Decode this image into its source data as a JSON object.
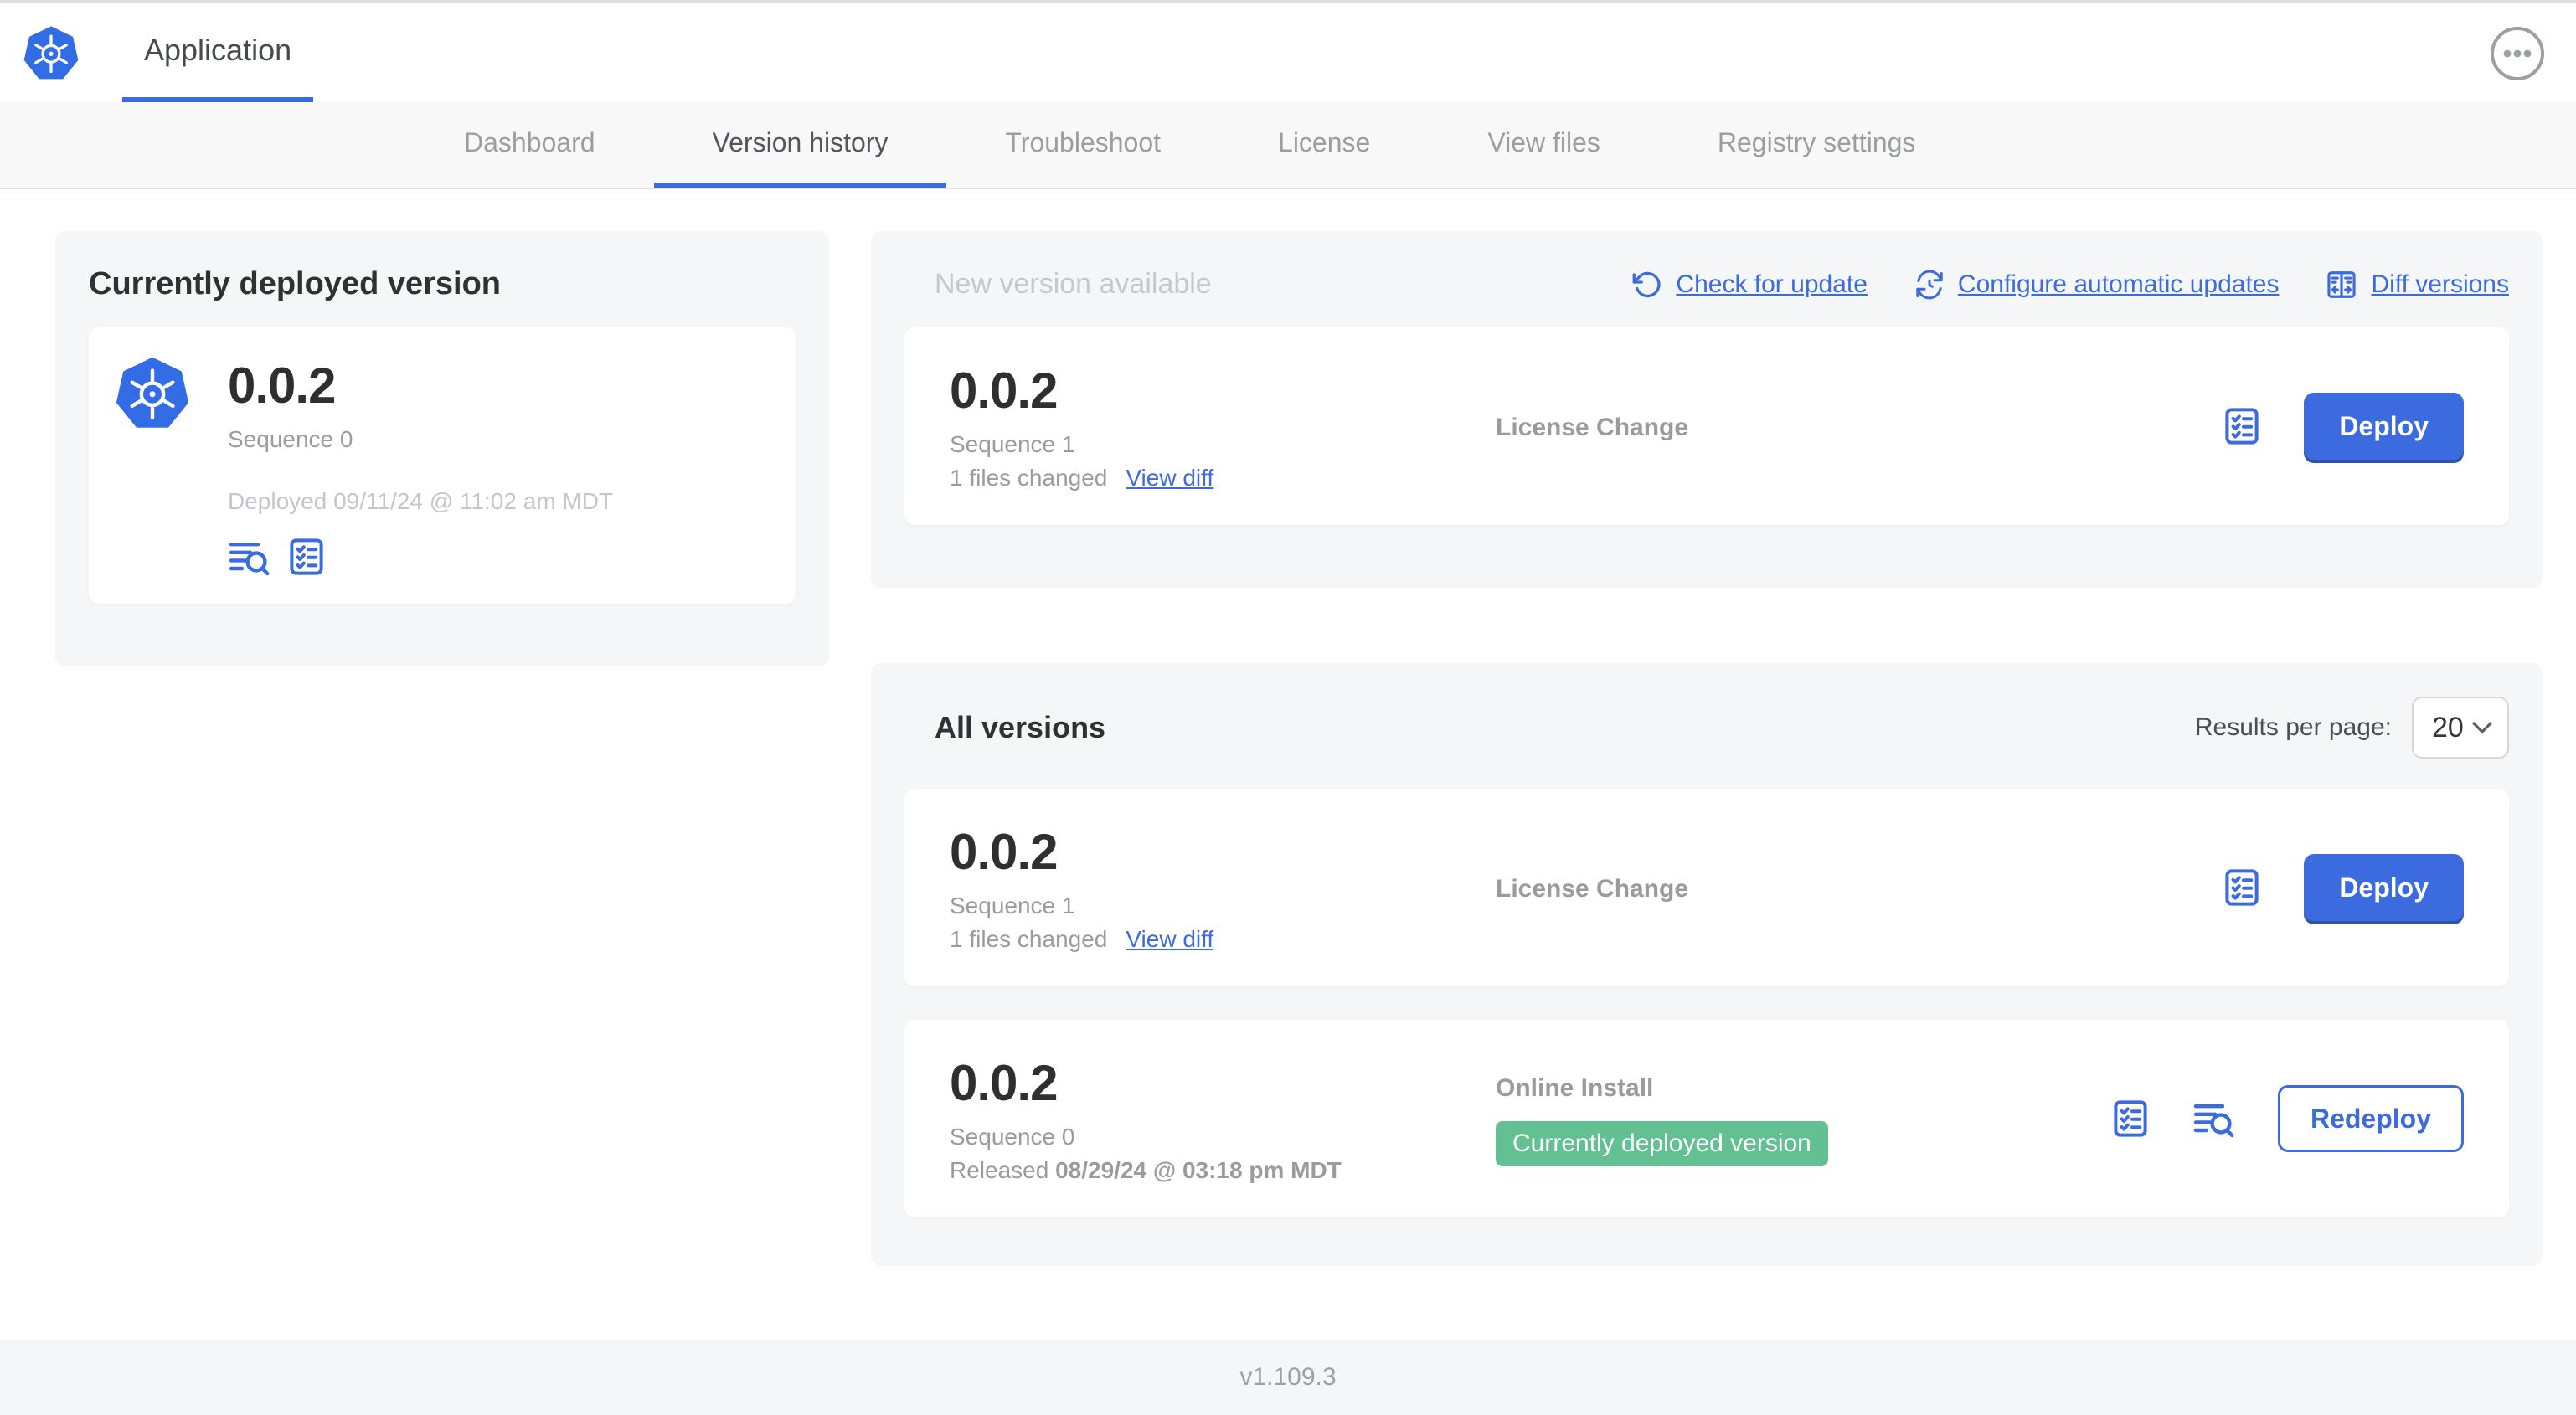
{
  "header": {
    "app_tab": "Application"
  },
  "nav": {
    "tabs": [
      {
        "label": "Dashboard"
      },
      {
        "label": "Version history"
      },
      {
        "label": "Troubleshoot"
      },
      {
        "label": "License"
      },
      {
        "label": "View files"
      },
      {
        "label": "Registry settings"
      }
    ]
  },
  "deployed_panel": {
    "title": "Currently deployed version",
    "version": "0.0.2",
    "sequence": "Sequence 0",
    "deployed_at": "Deployed 09/11/24 @ 11:02 am MDT"
  },
  "new_version_panel": {
    "title": "New version available",
    "links": {
      "check_for_update": "Check for update",
      "configure_automatic_updates": "Configure automatic updates",
      "diff_versions": "Diff versions"
    },
    "card": {
      "version": "0.0.2",
      "sequence": "Sequence 1",
      "files_changed": "1 files changed",
      "view_diff": "View diff",
      "source": "License Change",
      "action": "Deploy"
    }
  },
  "all_versions_panel": {
    "title": "All versions",
    "results_per_page_label": "Results per page:",
    "results_per_page_value": "20",
    "rows": [
      {
        "version": "0.0.2",
        "sequence": "Sequence 1",
        "files_changed": "1 files changed",
        "view_diff": "View diff",
        "source": "License Change",
        "action": "Deploy"
      },
      {
        "version": "0.0.2",
        "sequence": "Sequence 0",
        "released_prefix": "Released ",
        "released_date": "08/29/24 @ 03:18 pm MDT",
        "source": "Online Install",
        "badge": "Currently deployed version",
        "action": "Redeploy"
      }
    ]
  },
  "footer": {
    "version": "v1.109.3"
  },
  "colors": {
    "accent": "#3b6bde",
    "accent_dark": "#2d54ac",
    "green": "#62c093",
    "panel_bg": "#f4f6f8",
    "gray_text": "#9b9b9b",
    "light_gray_text": "#c3c6cb",
    "k8s_blue": "#326DE6"
  }
}
